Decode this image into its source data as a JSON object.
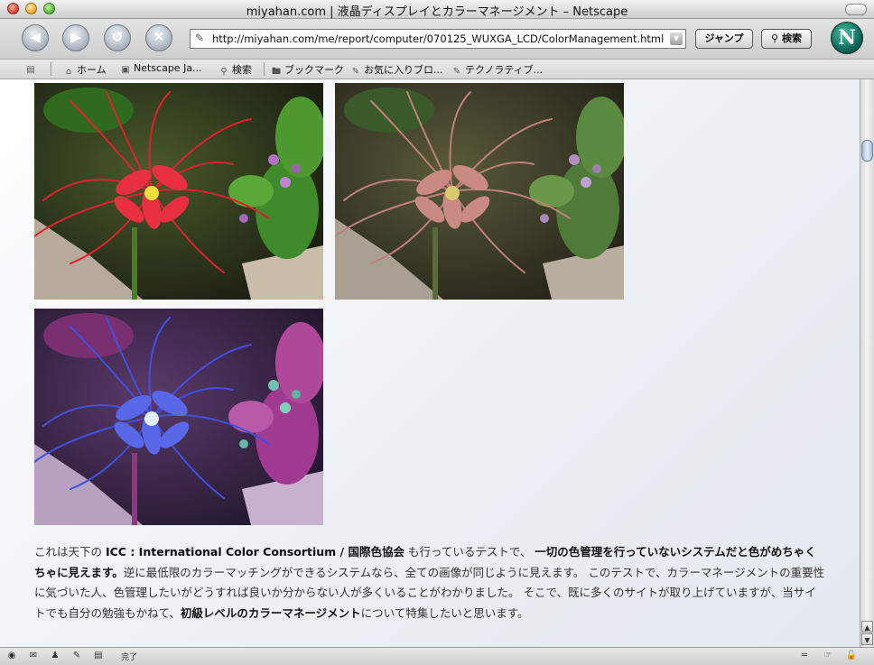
{
  "window": {
    "title": "miyahan.com | 液晶ディスプレイとカラーマネージメント – Netscape"
  },
  "toolbar": {
    "url": "http://miyahan.com/me/report/computer/070125_WUXGA_LCD/ColorManagement.html",
    "jump_label": "ジャンプ",
    "search_label": "検索",
    "logo_letter": "N"
  },
  "personal_toolbar": {
    "items": [
      "ホーム",
      "Netscape Ja...",
      "検索",
      "ブックマーク",
      "お気に入りブロ...",
      "テクノラティブ..."
    ]
  },
  "content": {
    "images": [
      {
        "description": "red-spider-lily",
        "variant": "original"
      },
      {
        "description": "red-spider-lily",
        "variant": "desaturated"
      },
      {
        "description": "red-spider-lily",
        "variant": "inverted-blue"
      }
    ],
    "paragraph": {
      "p1": "これは天下の ",
      "b1": "ICC : International Color Consortium / 国際色協会",
      "p2": " も行っているテストで、 ",
      "b2": "一切の色管理を行っていないシステムだと色がめちゃくちゃに見えます。",
      "p3": "逆に最低限のカラーマッチングができるシステムなら、全ての画像が同じように見えます。 このテストで、カラーマネージメントの重要性に気づいた人、色管理したいがどうすれば良いか分からない人が多くいることがわかりました。 そこで、既に多くのサイトが取り上げていますが、当サイトでも自分の勉強もかねて、",
      "b3": "初級レベルのカラーマネージメント",
      "p4": "について特集したいと思います。"
    }
  },
  "statusbar": {
    "text": "完了"
  }
}
